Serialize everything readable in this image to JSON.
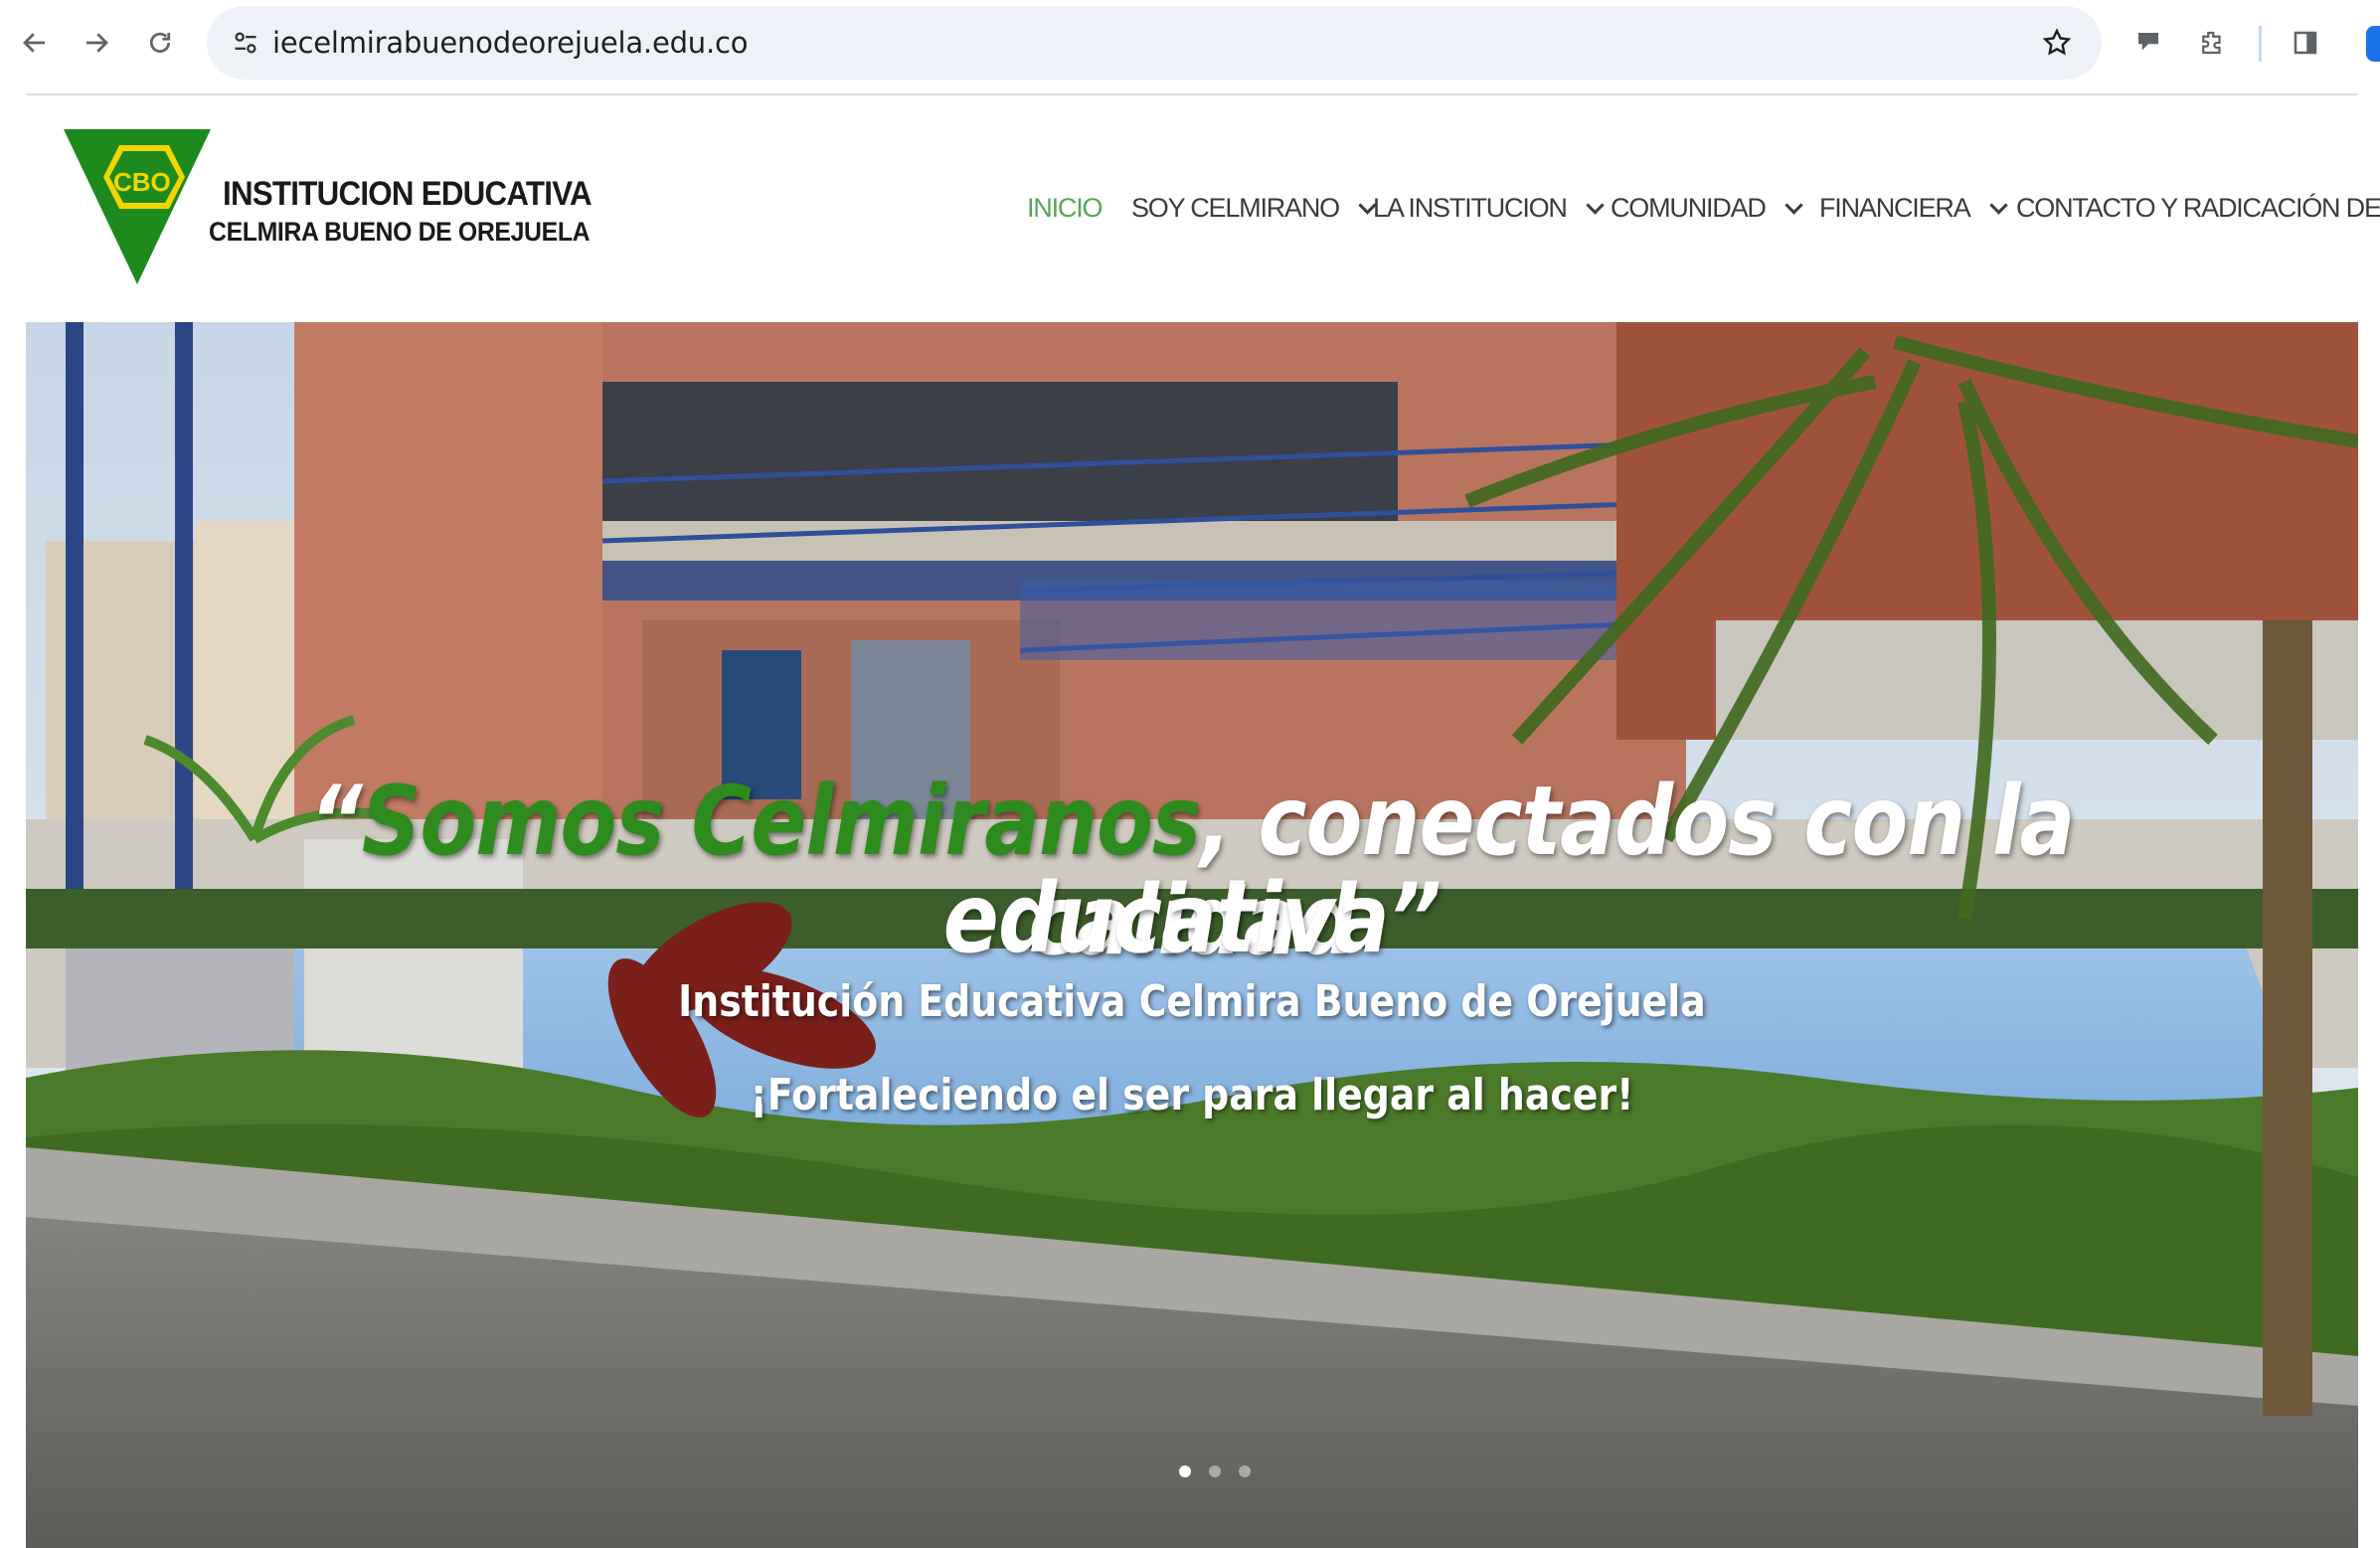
{
  "browser": {
    "url": "iecelmirabuenodeorejuela.edu.co"
  },
  "site": {
    "logo": {
      "badge": "CBO",
      "line1": "INSTITUCION EDUCATIVA",
      "line2": "CELMIRA BUENO DE OREJUELA",
      "colors": {
        "green": "#1e8a1e",
        "yellow": "#f2d600"
      }
    },
    "menu": [
      {
        "label": "INICIO",
        "active": true,
        "dropdown": false
      },
      {
        "label": "SOY CELMIRANO",
        "active": false,
        "dropdown": true
      },
      {
        "label": "LA INSTITUCION",
        "active": false,
        "dropdown": true
      },
      {
        "label": "COMUNIDAD",
        "active": false,
        "dropdown": true
      },
      {
        "label": "FINANCIERA",
        "active": false,
        "dropdown": true
      },
      {
        "label": "CONTACTO Y RADICACIÓN DE PQR",
        "active": false,
        "dropdown": false
      }
    ],
    "accent": "#56a75a"
  },
  "hero": {
    "quote_open": "“",
    "quote_green": "Somos Celmiranos",
    "quote_rest_line1": ", conectados con la calidad",
    "quote_line2": "educativa”",
    "subtitle": "Institución Educativa Celmira Bueno de Orejuela",
    "motto": "¡Fortaleciendo el ser para llegar al hacer!",
    "slides": 3,
    "active_slide": 1
  }
}
